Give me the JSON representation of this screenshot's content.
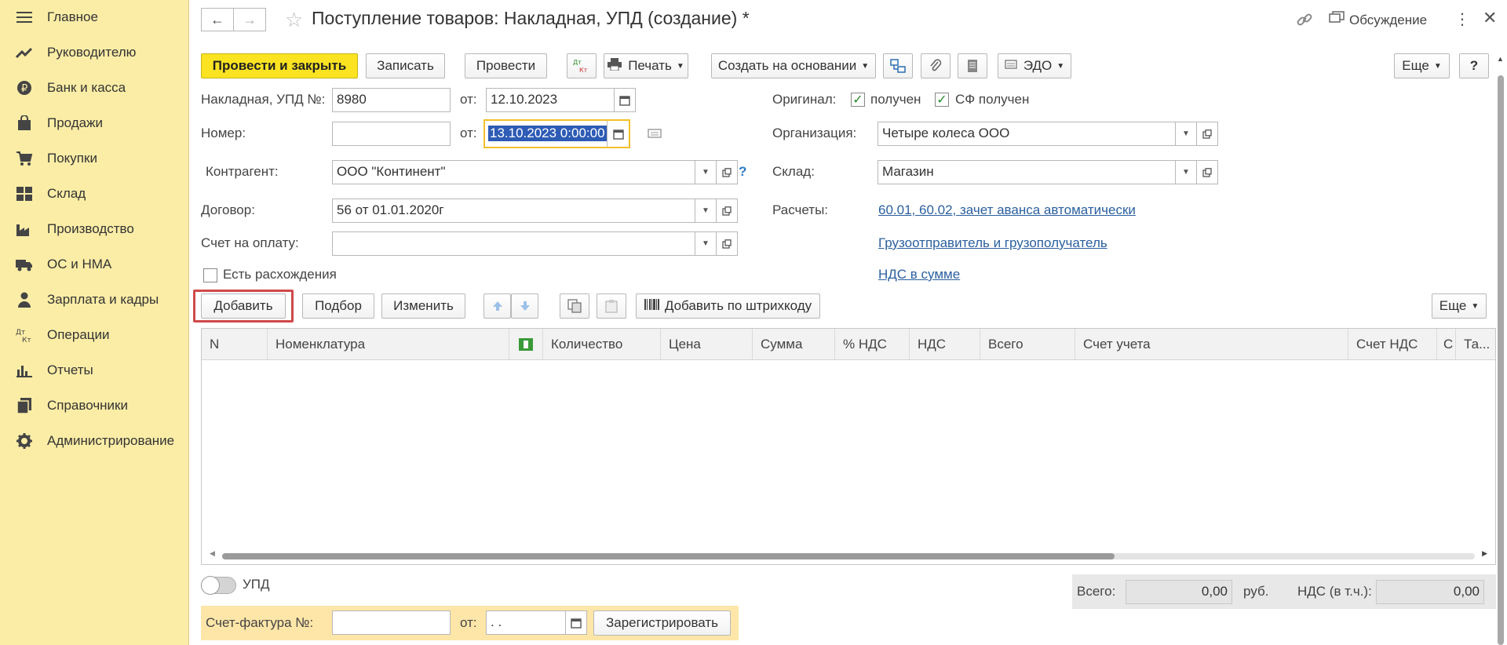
{
  "sidebar": {
    "items": [
      {
        "label": "Главное",
        "icon": "menu-icon"
      },
      {
        "label": "Руководителю",
        "icon": "trend-icon"
      },
      {
        "label": "Банк и касса",
        "icon": "ruble-coin-icon"
      },
      {
        "label": "Продажи",
        "icon": "shopping-bag-icon"
      },
      {
        "label": "Покупки",
        "icon": "cart-icon"
      },
      {
        "label": "Склад",
        "icon": "warehouse-icon"
      },
      {
        "label": "Производство",
        "icon": "factory-icon"
      },
      {
        "label": "ОС и НМА",
        "icon": "truck-icon"
      },
      {
        "label": "Зарплата и кадры",
        "icon": "person-icon"
      },
      {
        "label": "Операции",
        "icon": "debit-credit-icon"
      },
      {
        "label": "Отчеты",
        "icon": "bar-chart-icon"
      },
      {
        "label": "Справочники",
        "icon": "books-icon"
      },
      {
        "label": "Администрирование",
        "icon": "gear-icon"
      }
    ]
  },
  "header": {
    "title": "Поступление товаров: Накладная, УПД (создание) *",
    "discussion_label": "Обсуждение"
  },
  "toolbar": {
    "post_close": "Провести и закрыть",
    "save": "Записать",
    "post": "Провести",
    "dt_kt": "Дт Кт",
    "print": "Печать",
    "create_based": "Создать на основании",
    "edo": "ЭДО",
    "more": "Еще",
    "help": "?"
  },
  "form": {
    "invoice_label": "Накладная, УПД №:",
    "invoice_no": "8980",
    "from_label": "от:",
    "invoice_date": "12.10.2023",
    "number_label": "Номер:",
    "number_value": "",
    "number_date": "13.10.2023  0:00:00",
    "original_label": "Оригинал:",
    "original_received": "получен",
    "sf_received": "СФ получен",
    "org_label": "Организация:",
    "org_value": "Четыре колеса ООО",
    "counterparty_label": "Контрагент:",
    "counterparty_value": "ООО \"Континент\"",
    "warehouse_label": "Склад:",
    "warehouse_value": "Магазин",
    "contract_label": "Договор:",
    "contract_value": "56 от 01.01.2020г",
    "settlements_label": "Расчеты:",
    "settlements_link": "60.01, 60.02, зачет аванса автоматически",
    "payment_label": "Счет на оплату:",
    "payment_value": "",
    "shipper_link": "Грузоотправитель и грузополучатель",
    "discrepancies_label": "Есть расхождения",
    "vat_link": "НДС в сумме"
  },
  "table_toolbar": {
    "add": "Добавить",
    "pick": "Подбор",
    "change": "Изменить",
    "barcode": "Добавить по штрихкоду",
    "more": "Еще"
  },
  "table": {
    "columns": [
      "N",
      "Номенклатура",
      "",
      "Количество",
      "Цена",
      "Сумма",
      "% НДС",
      "НДС",
      "Всего",
      "Счет учета",
      "Счет НДС",
      "С",
      "Та..."
    ]
  },
  "bottom": {
    "upd_label": "УПД",
    "total_label": "Всего:",
    "total_value": "0,00",
    "currency": "руб.",
    "vat_label": "НДС (в т.ч.):",
    "vat_value": "0,00",
    "sf_label": "Счет-фактура №:",
    "sf_value": "",
    "sf_from_label": "от:",
    "sf_date": " .  .",
    "register": "Зарегистрировать"
  }
}
